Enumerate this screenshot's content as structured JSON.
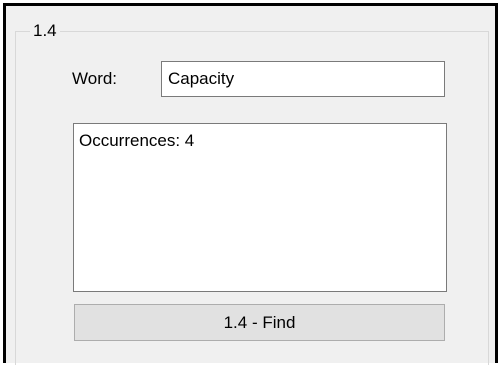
{
  "group": {
    "title": "1.4"
  },
  "word": {
    "label": "Word:",
    "value": "Capacity"
  },
  "result": {
    "text": "Occurrences: 4"
  },
  "find_button": {
    "label": "1.4 - Find"
  }
}
